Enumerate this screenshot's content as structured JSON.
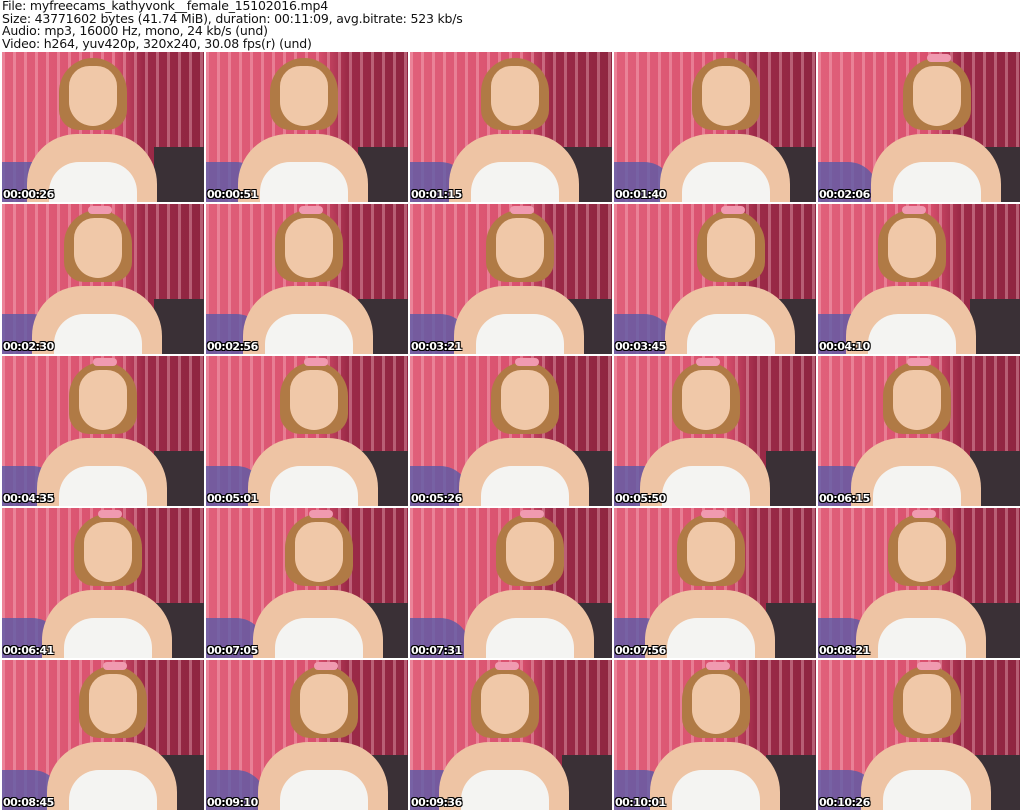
{
  "header": {
    "file_line": "File: myfreecams_kathyvonk__female_15102016.mp4",
    "size_line": "Size: 43771602 bytes (41.74 MiB), duration: 00:11:09, avg.bitrate: 523 kb/s",
    "audio_line": "Audio: mp3, 16000 Hz, mono, 24 kb/s (und)",
    "video_line": "Video: h264, yuv420p, 320x240, 30.08 fps(r) (und)"
  },
  "thumbnails": [
    {
      "timestamp": "00:00:26"
    },
    {
      "timestamp": "00:00:51"
    },
    {
      "timestamp": "00:01:15"
    },
    {
      "timestamp": "00:01:40"
    },
    {
      "timestamp": "00:02:06"
    },
    {
      "timestamp": "00:02:30"
    },
    {
      "timestamp": "00:02:56"
    },
    {
      "timestamp": "00:03:21"
    },
    {
      "timestamp": "00:03:45"
    },
    {
      "timestamp": "00:04:10"
    },
    {
      "timestamp": "00:04:35"
    },
    {
      "timestamp": "00:05:01"
    },
    {
      "timestamp": "00:05:26"
    },
    {
      "timestamp": "00:05:50"
    },
    {
      "timestamp": "00:06:15"
    },
    {
      "timestamp": "00:06:41"
    },
    {
      "timestamp": "00:07:05"
    },
    {
      "timestamp": "00:07:31"
    },
    {
      "timestamp": "00:07:56"
    },
    {
      "timestamp": "00:08:21"
    },
    {
      "timestamp": "00:08:45"
    },
    {
      "timestamp": "00:09:10"
    },
    {
      "timestamp": "00:09:36"
    },
    {
      "timestamp": "00:10:01"
    },
    {
      "timestamp": "00:10:26"
    }
  ]
}
